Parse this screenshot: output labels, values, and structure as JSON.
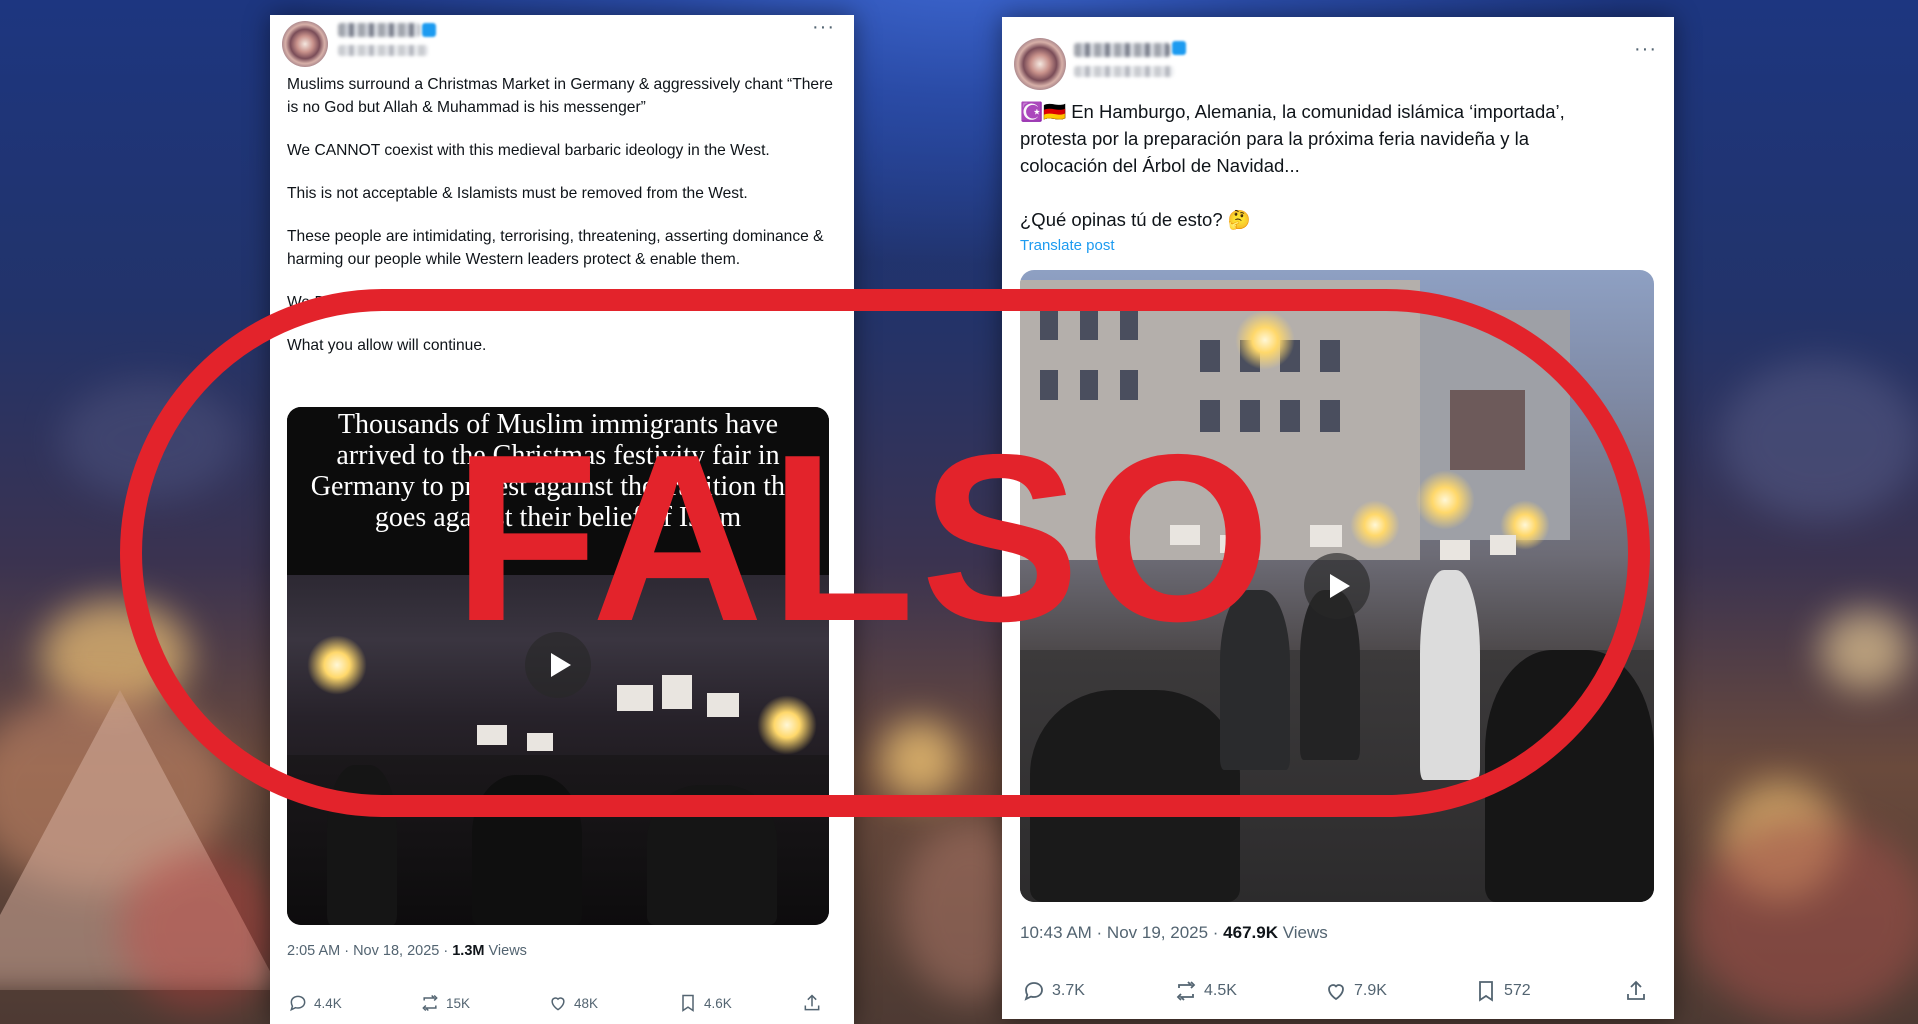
{
  "stamp": {
    "text": "FALSO",
    "color": "#e3232b"
  },
  "left_post": {
    "author_name": "",
    "author_handle": "",
    "more_glyph": "···",
    "paragraphs": [
      "Muslims surround a Christmas Market in Germany & aggressively chant “There is no God but Allah & Muhammad is his messenger”",
      "We CANNOT coexist with this medieval barbaric ideology in the West.",
      "This is not acceptable & Islamists must be removed from the West.",
      "These people are intimidating, terrorising, threatening, asserting dominance & harming our people while Western leaders protect & enable them.",
      "We DON’T have to live like this.",
      "What you allow will continue."
    ],
    "video_caption": "Thousands of Muslim immigrants have arrived to the Christmas festivity fair in Germany to protest against the tradition that goes against their belief of Islam",
    "timestamp": "2:05 AM · Nov 18, 2025 · ",
    "views_count": "1.3M",
    "views_label": " Views",
    "replies": "4.4K",
    "reposts": "15K",
    "likes": "48K",
    "bookmarks": "4.6K"
  },
  "right_post": {
    "author_name": "",
    "author_handle": "",
    "more_glyph": "···",
    "text_line1": "☪️🇩🇪 En Hamburgo, Alemania, la comunidad islámica ‘importada’, protesta por la preparación para la próxima feria navideña y la colocación del Árbol de Navidad...",
    "text_line2": "¿Qué opinas tú de esto? 🤔",
    "translate_label": "Translate post",
    "timestamp": "10:43 AM · Nov 19, 2025 · ",
    "views_count": "467.9K",
    "views_label": " Views",
    "replies": "3.7K",
    "reposts": "4.5K",
    "likes": "7.9K",
    "bookmarks": "572"
  },
  "icons": {
    "reply": "reply-icon",
    "repost": "repost-icon",
    "like": "heart-icon",
    "bookmark": "bookmark-icon",
    "share": "share-icon",
    "play": "play-icon"
  }
}
